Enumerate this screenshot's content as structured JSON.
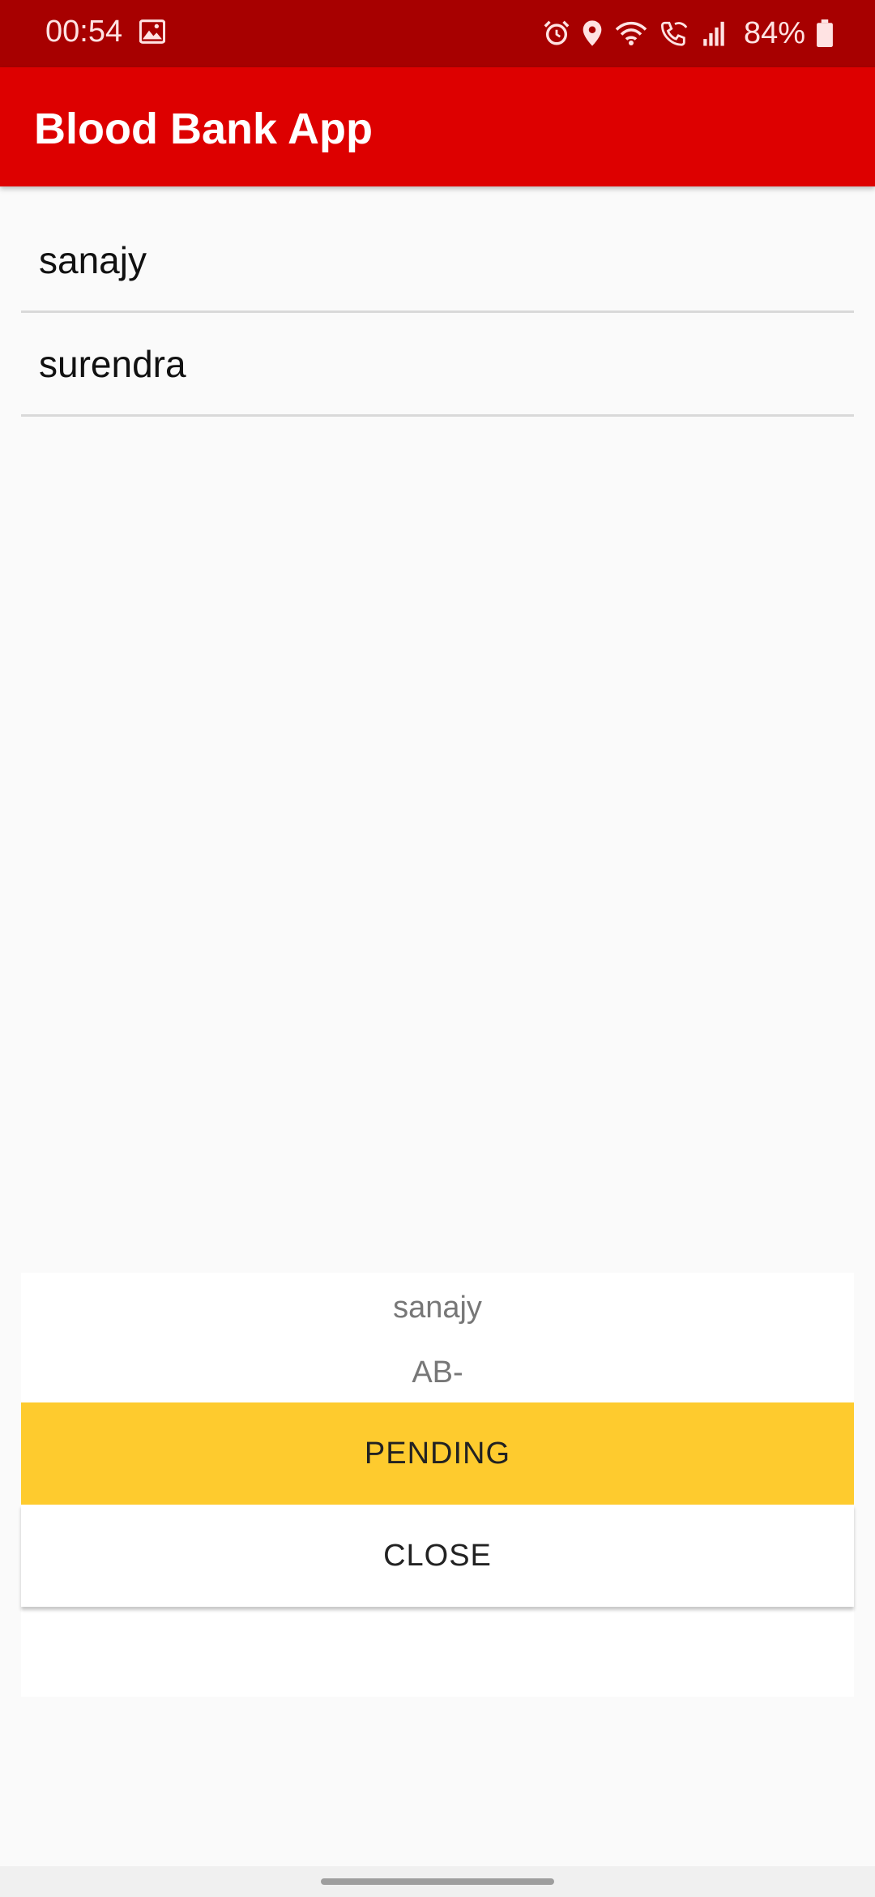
{
  "status_bar": {
    "time": "00:54",
    "battery": "84%",
    "icons": [
      "image-icon",
      "alarm-icon",
      "location-icon",
      "wifi-icon",
      "wifi-call-icon",
      "signal-icon",
      "battery-icon"
    ]
  },
  "app_bar": {
    "title": "Blood Bank App",
    "color": "#dd0000"
  },
  "list": {
    "items": [
      {
        "name": "sanajy"
      },
      {
        "name": "surendra"
      }
    ]
  },
  "dialog": {
    "name": "sanajy",
    "blood_group": "AB-",
    "pending_label": "PENDING",
    "close_label": "CLOSE",
    "pending_color": "#fecb2e"
  }
}
